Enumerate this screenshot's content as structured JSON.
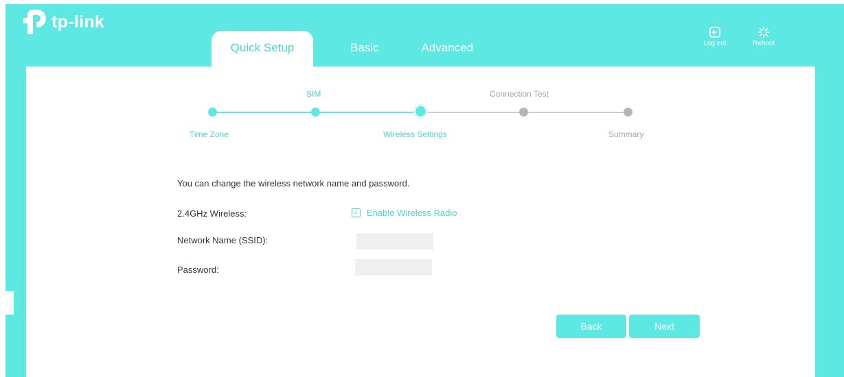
{
  "brand": {
    "logo_text": "tp-link"
  },
  "tabs": [
    {
      "label": "Quick Setup",
      "active": true
    },
    {
      "label": "Basic",
      "active": false
    },
    {
      "label": "Advanced",
      "active": false
    }
  ],
  "header_actions": {
    "logout_label": "Log out",
    "reboot_label": "Reboot"
  },
  "steps": [
    {
      "label": "Time Zone",
      "state": "done"
    },
    {
      "label": "SIM",
      "state": "done"
    },
    {
      "label": "Wireless Settings",
      "state": "current"
    },
    {
      "label": "Connection Test",
      "state": "pending"
    },
    {
      "label": "Summary",
      "state": "pending"
    }
  ],
  "form": {
    "intro": "You can change the wireless network name and password.",
    "wireless_label": "2.4GHz Wireless:",
    "enable_radio_label": "Enable Wireless Radio",
    "enable_radio_checked": true,
    "ssid_label": "Network Name (SSID):",
    "ssid_value": "",
    "password_label": "Password:",
    "password_value": ""
  },
  "buttons": {
    "back_label": "Back",
    "next_label": "Next"
  },
  "colors": {
    "accent": "#5ee8e3",
    "accent_text": "#4fd3d0",
    "inactive": "#b5b5b5"
  }
}
